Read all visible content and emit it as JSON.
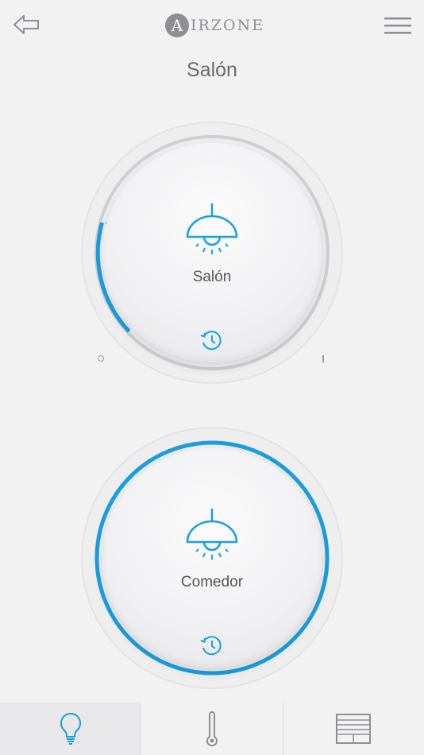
{
  "header": {
    "back_icon": "back-arrow-icon",
    "logo_initial": "A",
    "logo_rest": "IRZONE",
    "menu_icon": "hamburger-menu-icon"
  },
  "page": {
    "title": "Salón"
  },
  "colors": {
    "accent": "#1a9ee0",
    "track": "#cfcfd3",
    "text": "#555555"
  },
  "zones": [
    {
      "label": "Salón",
      "icon": "ceiling-lamp-icon",
      "schedule_icon": "schedule-history-icon",
      "on": true,
      "level": 0.18
    },
    {
      "label": "Comedor",
      "icon": "ceiling-lamp-icon",
      "schedule_icon": "schedule-history-icon",
      "on": true,
      "level": 1.0
    }
  ],
  "tabbar": {
    "active": "lighting",
    "tabs": [
      {
        "id": "lighting",
        "icon": "lightbulb-icon"
      },
      {
        "id": "climate",
        "icon": "thermometer-icon"
      },
      {
        "id": "blinds",
        "icon": "window-blinds-icon"
      }
    ]
  }
}
